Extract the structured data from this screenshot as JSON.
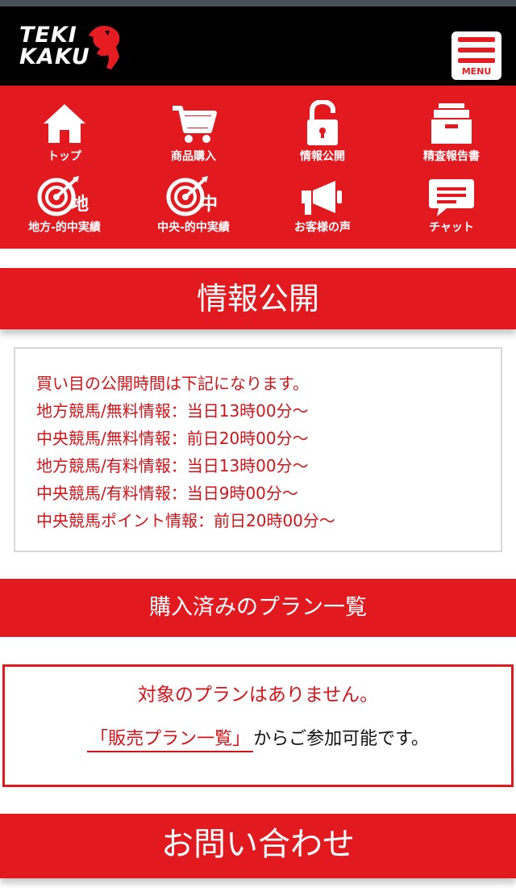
{
  "header": {
    "logo_line1": "TEKI",
    "logo_line2": "KAKU",
    "menu_label": "MENU"
  },
  "nav": {
    "items": [
      {
        "label": "トップ",
        "icon": "home-icon"
      },
      {
        "label": "商品購入",
        "icon": "cart-icon"
      },
      {
        "label": "情報公開",
        "icon": "unlock-icon"
      },
      {
        "label": "精査報告書",
        "icon": "filing-cabinet-icon"
      },
      {
        "label": "地方-的中実績",
        "icon": "target-local-icon",
        "icon_char": "地"
      },
      {
        "label": "中央-的中実績",
        "icon": "target-central-icon",
        "icon_char": "中"
      },
      {
        "label": "お客様の声",
        "icon": "megaphone-icon"
      },
      {
        "label": "チャット",
        "icon": "chat-bubble-icon"
      }
    ]
  },
  "info_section": {
    "title": "情報公開",
    "lines": [
      "買い目の公開時間は下記になります。",
      "地方競馬/無料情報：当日13時00分〜",
      "中央競馬/無料情報：前日20時00分〜",
      "地方競馬/有料情報：当日13時00分〜",
      "中央競馬/有料情報：当日9時00分〜",
      "中央競馬ポイント情報：前日20時00分〜"
    ]
  },
  "plans_section": {
    "title": "購入済みのプラン一覧",
    "empty_message": "対象のプランはありません。",
    "link_text": "「販売プラン一覧」",
    "suffix_text": "からご参加可能です。"
  },
  "contact_section": {
    "title": "お問い合わせ"
  },
  "colors": {
    "brand_red": "#e21a20",
    "text_red": "#d0141a",
    "header_black": "#000000"
  }
}
